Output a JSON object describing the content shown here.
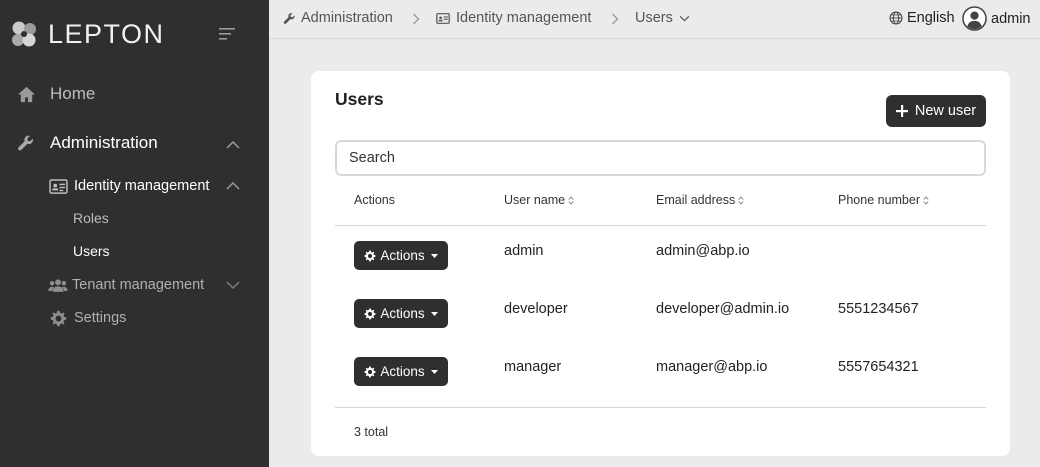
{
  "brand": {
    "name": "LEPTON"
  },
  "sidebar": {
    "home": "Home",
    "administration": "Administration",
    "identity_management": "Identity management",
    "roles": "Roles",
    "users": "Users",
    "tenant_management": "Tenant management",
    "settings": "Settings"
  },
  "breadcrumb": {
    "administration": "Administration",
    "identity_management": "Identity management",
    "users": "Users"
  },
  "header": {
    "language": "English",
    "user": "admin"
  },
  "page": {
    "title": "Users",
    "new_user_label": "New user",
    "search_placeholder": "Search",
    "columns": [
      "Actions",
      "User name",
      "Email address",
      "Phone number"
    ],
    "action_label": "Actions",
    "rows": [
      {
        "username": "admin",
        "email": "admin@abp.io",
        "phone": ""
      },
      {
        "username": "developer",
        "email": "developer@admin.io",
        "phone": "5551234567"
      },
      {
        "username": "manager",
        "email": "manager@abp.io",
        "phone": "5557654321"
      }
    ],
    "total": "3 total"
  },
  "colors": {
    "sidebar_bg": "#2f2f2f",
    "page_bg": "#ebebeb",
    "button_bg": "#2f2f2f",
    "card_bg": "#ffffff"
  }
}
